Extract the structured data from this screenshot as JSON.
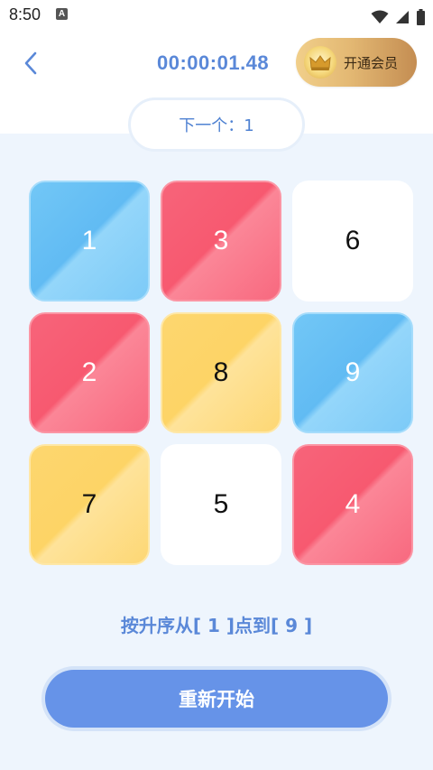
{
  "status_bar": {
    "time": "8:50",
    "notification_icon_letter": "A",
    "icons": [
      "wifi-icon",
      "signal-icon",
      "battery-icon"
    ]
  },
  "header": {
    "timer": "00:00:01.48",
    "vip_label": "开通会员"
  },
  "game": {
    "next_label": "下一个：1",
    "tiles": [
      {
        "number": "1",
        "color": "blue"
      },
      {
        "number": "3",
        "color": "red"
      },
      {
        "number": "6",
        "color": "white"
      },
      {
        "number": "2",
        "color": "red"
      },
      {
        "number": "8",
        "color": "yellow"
      },
      {
        "number": "9",
        "color": "blue"
      },
      {
        "number": "7",
        "color": "yellow"
      },
      {
        "number": "5",
        "color": "white"
      },
      {
        "number": "4",
        "color": "red"
      }
    ],
    "instruction": "按升序从[ 1 ]点到[ 9 ]",
    "restart_label": "重新开始"
  },
  "colors": {
    "accent_blue": "#5a88d8",
    "button_blue": "#6693e8",
    "tile_blue": "#6cc1f5",
    "tile_red": "#f75f76",
    "tile_yellow": "#fdd66f",
    "vip_gold": "#e3b873"
  }
}
